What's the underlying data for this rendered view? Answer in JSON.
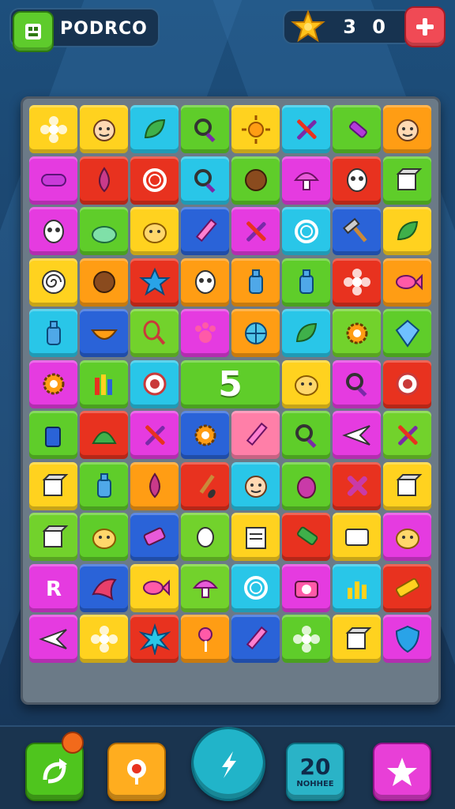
{
  "header": {
    "logo_text": "PODRCO",
    "score": "3 0",
    "plus_icon": "plus-icon",
    "star_icon": "star-icon"
  },
  "board": {
    "special_tile_value": "5",
    "rows": [
      [
        [
          "yellow",
          "flower"
        ],
        [
          "yellow",
          "face"
        ],
        [
          "cyan",
          "leaf"
        ],
        [
          "green",
          "magnifier"
        ],
        [
          "yellow",
          "sun"
        ],
        [
          "cyan",
          "tools"
        ],
        [
          "green",
          "flashlight"
        ],
        [
          "orange",
          "face"
        ]
      ],
      [
        [
          "magenta",
          "capsule"
        ],
        [
          "red",
          "drop"
        ],
        [
          "red",
          "ring"
        ],
        [
          "cyan",
          "magnifier"
        ],
        [
          "green",
          "ball"
        ],
        [
          "magenta",
          "mushroom"
        ],
        [
          "red",
          "mask"
        ],
        [
          "green",
          "box"
        ]
      ],
      [
        [
          "magenta",
          "mask"
        ],
        [
          "green",
          "bush"
        ],
        [
          "yellow",
          "creature"
        ],
        [
          "blue",
          "pencil"
        ],
        [
          "magenta",
          "tools"
        ],
        [
          "cyan",
          "ring"
        ],
        [
          "blue",
          "hammer"
        ],
        [
          "yellow",
          "leaf"
        ]
      ],
      [
        [
          "yellow",
          "swirl"
        ],
        [
          "orange",
          "ball"
        ],
        [
          "red",
          "star"
        ],
        [
          "orange",
          "mask"
        ],
        [
          "orange",
          "bottle"
        ],
        [
          "green",
          "bottle"
        ],
        [
          "red",
          "flower"
        ],
        [
          "orange",
          "fish"
        ]
      ],
      [
        [
          "cyan",
          "bottle"
        ],
        [
          "blue",
          "bowl"
        ],
        [
          "lime",
          "racket"
        ],
        [
          "magenta",
          "paw"
        ],
        [
          "orange",
          "wheel"
        ],
        [
          "cyan",
          "leaf"
        ],
        [
          "lime",
          "gear"
        ],
        [
          "green",
          "gem"
        ]
      ],
      [
        [
          "magenta",
          "gear"
        ],
        [
          "green",
          "crayons"
        ],
        [
          "cyan",
          "target"
        ],
        [
          "BIG",
          "5"
        ],
        [
          "yellow",
          "creature"
        ],
        [
          "magenta",
          "magnifier"
        ],
        [
          "red",
          "target"
        ]
      ],
      [
        [
          "green",
          "cup"
        ],
        [
          "red",
          "hat"
        ],
        [
          "magenta",
          "tools"
        ],
        [
          "blue",
          "gear"
        ],
        [
          "pink",
          "pencil"
        ],
        [
          "green",
          "magnifier"
        ],
        [
          "magenta",
          "plane"
        ],
        [
          "lime",
          "tools"
        ]
      ],
      [
        [
          "yellow",
          "box"
        ],
        [
          "green",
          "bottle"
        ],
        [
          "orange",
          "drop"
        ],
        [
          "red",
          "brush"
        ],
        [
          "cyan",
          "face"
        ],
        [
          "green",
          "beetle"
        ],
        [
          "red",
          "cross"
        ],
        [
          "yellow",
          "box"
        ]
      ],
      [
        [
          "lime",
          "box"
        ],
        [
          "green",
          "creature"
        ],
        [
          "blue",
          "eraser"
        ],
        [
          "lime",
          "bone"
        ],
        [
          "yellow",
          "paper"
        ],
        [
          "red",
          "tube"
        ],
        [
          "yellow",
          "card"
        ],
        [
          "magenta",
          "creature"
        ]
      ],
      [
        [
          "magenta",
          "letter"
        ],
        [
          "blue",
          "bird"
        ],
        [
          "yellow",
          "fish"
        ],
        [
          "lime",
          "mushroom"
        ],
        [
          "cyan",
          "ring"
        ],
        [
          "magenta",
          "camera"
        ],
        [
          "cyan",
          "chart"
        ],
        [
          "red",
          "tape"
        ]
      ],
      [
        [
          "magenta",
          "plane"
        ],
        [
          "yellow",
          "flower"
        ],
        [
          "red",
          "burst"
        ],
        [
          "orange",
          "lollipop"
        ],
        [
          "blue",
          "pencil"
        ],
        [
          "green",
          "flower"
        ],
        [
          "yellow",
          "box"
        ],
        [
          "magenta",
          "shield"
        ]
      ]
    ]
  },
  "footer": {
    "boost_number": "20",
    "boost_label": "NOHHEE"
  },
  "colors": {
    "yellow": "#ffd21f",
    "pink": "#ff7fa8",
    "cyan": "#29c6e8",
    "green": "#5fcd2a",
    "orange": "#ff9d14",
    "magenta": "#e53be0",
    "red": "#e8321f",
    "blue": "#2a63d8",
    "lime": "#72d22c"
  }
}
